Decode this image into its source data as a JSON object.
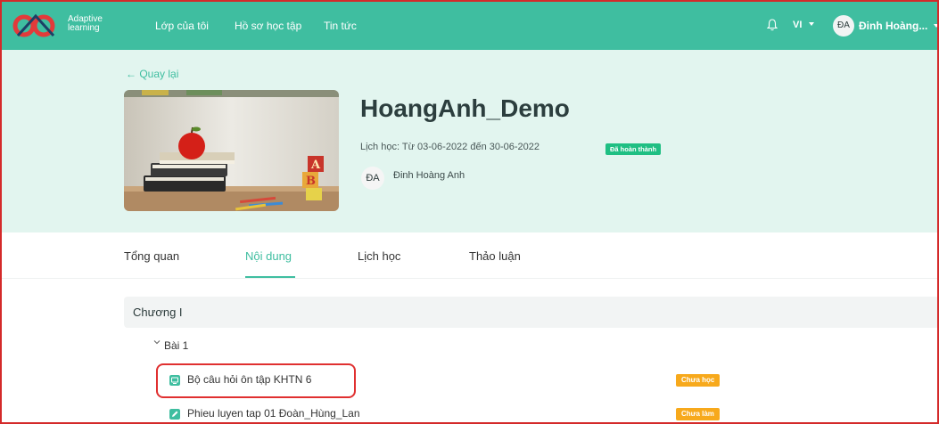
{
  "brand": {
    "line1": "Adaptive",
    "line2": "learning"
  },
  "nav": {
    "links": [
      "Lớp của tôi",
      "Hồ sơ học tập",
      "Tin tức"
    ],
    "lang": "VI",
    "user_initials": "ĐA",
    "user_name": "Đinh Hoàng..."
  },
  "course": {
    "back_label": "← Quay lại",
    "title": "HoangAnh_Demo",
    "schedule": "Lịch học: Từ 03-06-2022 đến 30-06-2022",
    "status": "Đã hoàn thành",
    "teacher_initials": "ĐA",
    "teacher_name": "Đinh Hoàng Anh"
  },
  "tabs": [
    {
      "label": "Tổng quan",
      "active": false
    },
    {
      "label": "Nội dung",
      "active": true
    },
    {
      "label": "Lịch học",
      "active": false
    },
    {
      "label": "Thảo luận",
      "active": false
    }
  ],
  "content": {
    "chapter": "Chương I",
    "lesson": "Bài 1",
    "items": [
      {
        "label": "Bộ câu hỏi ôn tập KHTN 6",
        "status": "Chưa học",
        "icon": "quiz-icon"
      },
      {
        "label": "Phieu luyen tap 01 Đoàn_Hùng_Lan",
        "status": "Chưa làm",
        "icon": "edit-icon"
      }
    ]
  },
  "colors": {
    "brand": "#3fbea0",
    "hero_bg": "#e2f5ef",
    "done_badge": "#1fbf83",
    "pending_badge": "#f7a91c",
    "highlight": "#e03030"
  }
}
